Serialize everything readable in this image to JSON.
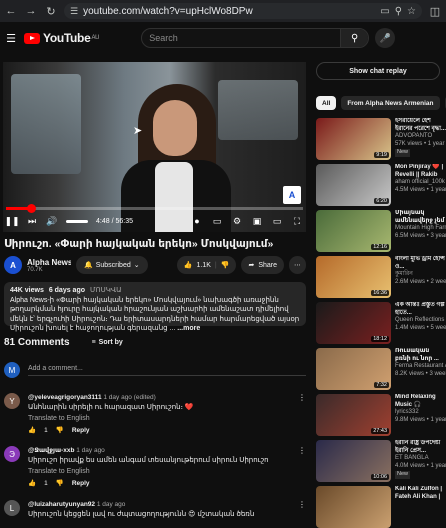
{
  "browser": {
    "url": "youtube.com/watch?v=upHclWo8DPw"
  },
  "yt": {
    "logo_text": "YouTube",
    "region": "AU",
    "search_placeholder": "Search"
  },
  "player": {
    "time": "4:48 / 56:35",
    "progress_fraction": 0.085,
    "watermark": "A"
  },
  "video": {
    "title": "Սիրուշո. «Փարի հայկական երեկո» Մոսկվայում»",
    "channel_name": "Alpha News...",
    "channel_subs": "70.7K",
    "channel_initial": "A",
    "subscribe_label": "Subscribed",
    "likes": "1.1K",
    "share_label": "Share",
    "views": "44K views",
    "age": "6 days ago",
    "location": "ՄՈՍԿՎԱ",
    "description": "Alpha News-ի «Փարի հայկական երեկո» Մոսկվայում» նախագծի առաջինն թողարկման հյուրը հայկական հրաշունյան աշխարհի ամենաշատ դիմելիով մեկն է՝ երգչուհի Սիրուշոն։ Դա երիտասարդների համար հարմարեցված այսօր Սիրուշոն խոսել է հաջողության գերազանց ... ",
    "more_label": "...more"
  },
  "comments": {
    "count_label": "81 Comments",
    "sort_label": "Sort by",
    "add_placeholder": "Add a comment...",
    "my_avatar": "M",
    "items": [
      {
        "avatar": "Y",
        "avatar_color": "#7a5a4a",
        "author": "@yeleveagrigoryan3111",
        "meta": "1 day ago (edited)",
        "text": "Անհնարին սիրելի ու հարազատ Սիրուշոն։ ❤️",
        "translate": "Translate to English",
        "likes": "1",
        "reply": "Reply"
      },
      {
        "avatar": "Э",
        "avatar_color": "#8a3ab9",
        "author": "@Ջավջյա-xxb",
        "meta": "1 day ago",
        "text": "Սիրուշո իրավք ես ամեն անգամ տեսանյութերում սիրուն Սիրուշո",
        "translate": "Translate to English",
        "likes": "1",
        "reply": "Reply"
      },
      {
        "avatar": "L",
        "avatar_color": "#555555",
        "author": "@luizaharutyunyan92",
        "meta": "1 day ago",
        "text": "Սիրուշոն կեցցեն լավ ու ժպտացողությունն 😍 մշտական ծեռն",
        "translate": "",
        "likes": "",
        "reply": ""
      }
    ]
  },
  "sidebar": {
    "chat_replay": "Show chat replay",
    "chips": [
      "All",
      "From Alpha News Armenian",
      "R"
    ],
    "recs": [
      {
        "title": "ইসরায়েলে হেঁশ ইরানের পরেশে বৃদ্ধা...",
        "channel": "ADVOPANTO",
        "views": "57K views • 1 year",
        "duration": "9:19",
        "badge": "New",
        "c1": "#7a1a1a",
        "c2": "#d8c48a"
      },
      {
        "title": "Mon Pinjiray ❤️ | Revelli || Rakib Musabbir",
        "channel": "aham official_100k",
        "views": "4.5M views • 1 year",
        "duration": "6:20",
        "badge": "",
        "c1": "#5a5a5a",
        "c2": "#c8c8c8"
      },
      {
        "title": "Միայնակ ամենավերջ չեմ կարող",
        "channel": "Mountain High Farm",
        "views": "6.5M views • 3 years",
        "duration": "12:16",
        "badge": "",
        "c1": "#4a6b3a",
        "c2": "#a8b870"
      },
      {
        "title": "বাংলা মুভি ড্রাম হেন্সি ও...",
        "channel": "কুমারিন",
        "views": "2.6M views • 2 weeks",
        "duration": "16:36",
        "badge": "",
        "c1": "#b56a2a",
        "c2": "#e8c070"
      },
      {
        "title": "এক আন্তঃ প্রস্তুত গল্প হাতে...",
        "channel": "Queen Reflections",
        "views": "1.4M views • 5 weeks",
        "duration": "18:12",
        "badge": "",
        "c1": "#1a1a1a",
        "c2": "#7a2020"
      },
      {
        "title": "Ռուսական բռնի ու նոր ...",
        "channel": "Ferma Restaurant A...",
        "views": "8.2K views • 3 weeks",
        "duration": "7:32",
        "badge": "",
        "c1": "#8a6a4a",
        "c2": "#d0a070"
      },
      {
        "title": "Mind Relaxing Music 🎧 #Sweet+Newest...",
        "channel": "lyrics332",
        "views": "9.8M views • 1 year",
        "duration": "27:43",
        "badge": "",
        "c1": "#3a2a2a",
        "c2": "#a04030"
      },
      {
        "title": "ইরানি রাষ্ট্র উপদেষ্টা ইরানি প্রেস...",
        "channel": "ET BANGLA",
        "views": "4.0M views • 1 year",
        "duration": "10:06",
        "badge": "New",
        "c1": "#2a2a4a",
        "c2": "#8a7060"
      },
      {
        "title": "Kali Kali Zulfon | Fateh Ali Khan |",
        "channel": "",
        "views": "",
        "duration": "",
        "badge": "",
        "c1": "#6a4a2a",
        "c2": "#caa070"
      }
    ]
  }
}
